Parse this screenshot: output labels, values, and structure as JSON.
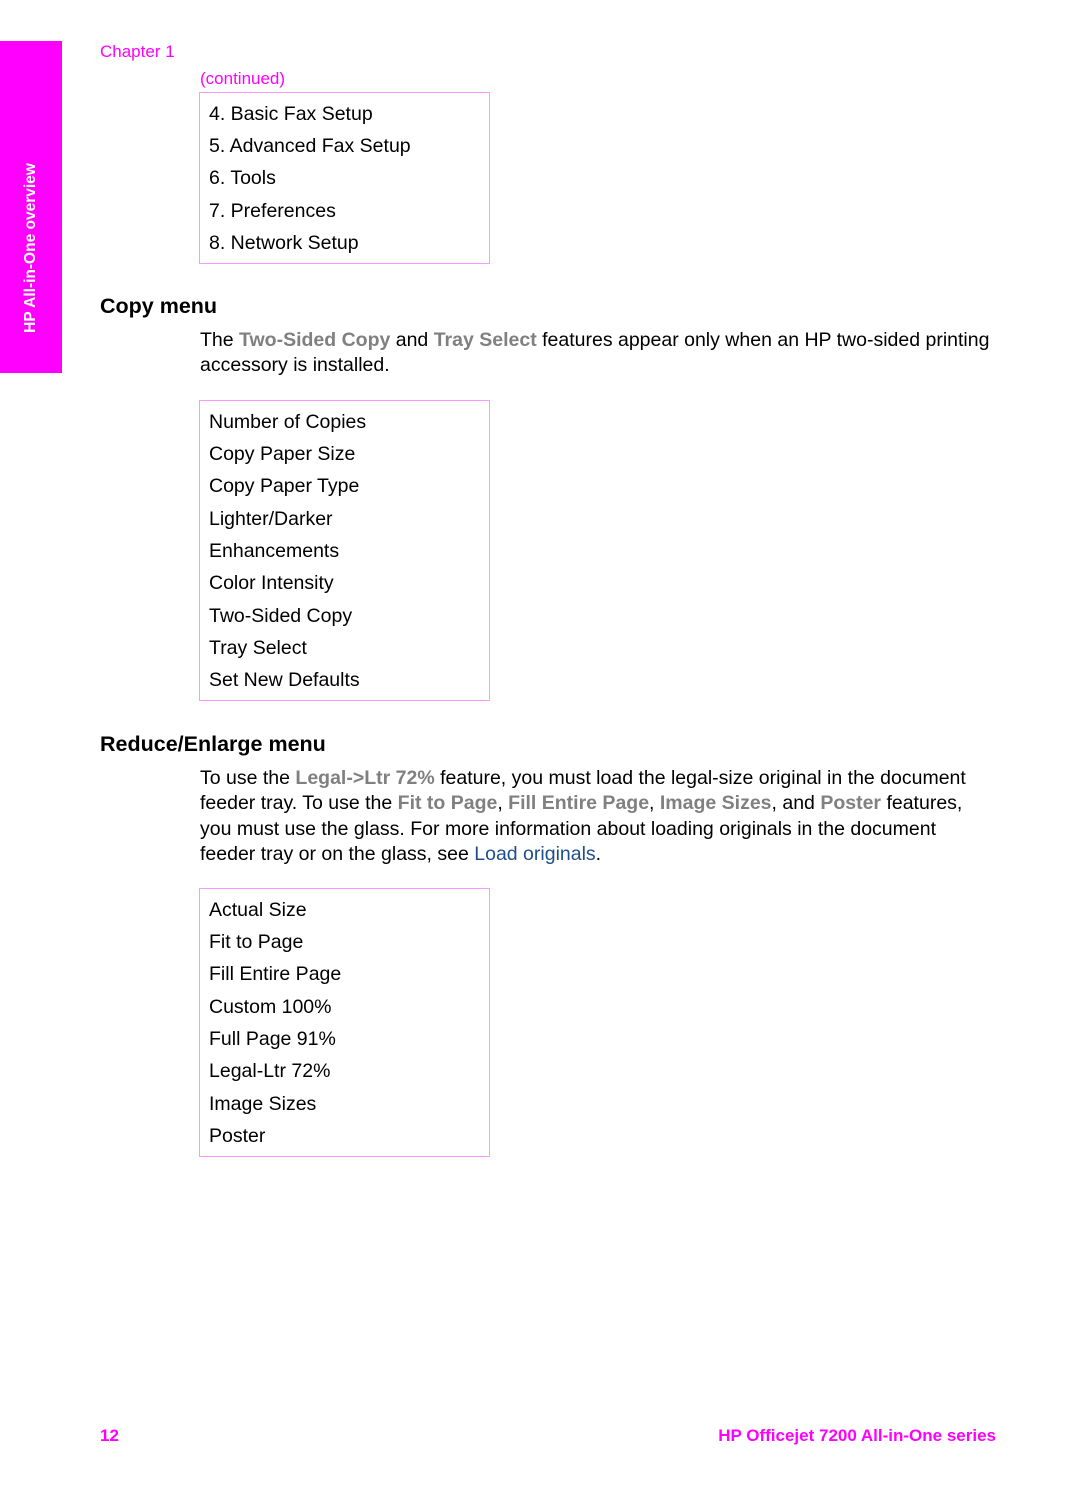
{
  "side_tab": {
    "label": "HP All-in-One overview",
    "color": "#ff00ff"
  },
  "header": {
    "chapter": "Chapter 1",
    "continued": "(continued)"
  },
  "fax_menu_continued": {
    "items": [
      "4. Basic Fax Setup",
      "5. Advanced Fax Setup",
      "6. Tools",
      "7. Preferences",
      "8. Network Setup"
    ]
  },
  "copy_menu": {
    "heading": "Copy menu",
    "para": {
      "t1": "The ",
      "ui1": "Two-Sided Copy",
      "t2": " and ",
      "ui2": "Tray Select",
      "t3": " features appear only when an HP two-sided printing accessory is installed."
    },
    "items": [
      "Number of Copies",
      "Copy Paper Size",
      "Copy Paper Type",
      "Lighter/Darker",
      "Enhancements",
      "Color Intensity",
      "Two-Sided Copy",
      "Tray Select",
      "Set New Defaults"
    ]
  },
  "reduce_enlarge_menu": {
    "heading": "Reduce/Enlarge menu",
    "para": {
      "t1": "To use the ",
      "ui1": "Legal->Ltr 72%",
      "t2": " feature, you must load the legal-size original in the document feeder tray. To use the ",
      "ui2": "Fit to Page",
      "t3": ", ",
      "ui3": "Fill Entire Page",
      "t4": ", ",
      "ui4": "Image Sizes",
      "t5": ", and ",
      "ui5": "Poster",
      "t6": " features, you must use the glass. For more information about loading originals in the document feeder tray or on the glass, see ",
      "link": "Load originals",
      "t7": "."
    },
    "items": [
      "Actual Size",
      "Fit to Page",
      "Fill Entire Page",
      "Custom 100%",
      "Full Page 91%",
      "Legal-Ltr 72%",
      "Image Sizes",
      "Poster"
    ]
  },
  "footer": {
    "page_number": "12",
    "product_title": "HP Officejet 7200 All-in-One series"
  },
  "colors": {
    "accent": "#ff00ff",
    "box_border": "#ff99ff",
    "ui_term": "#808080",
    "link": "#1f4e8c"
  }
}
